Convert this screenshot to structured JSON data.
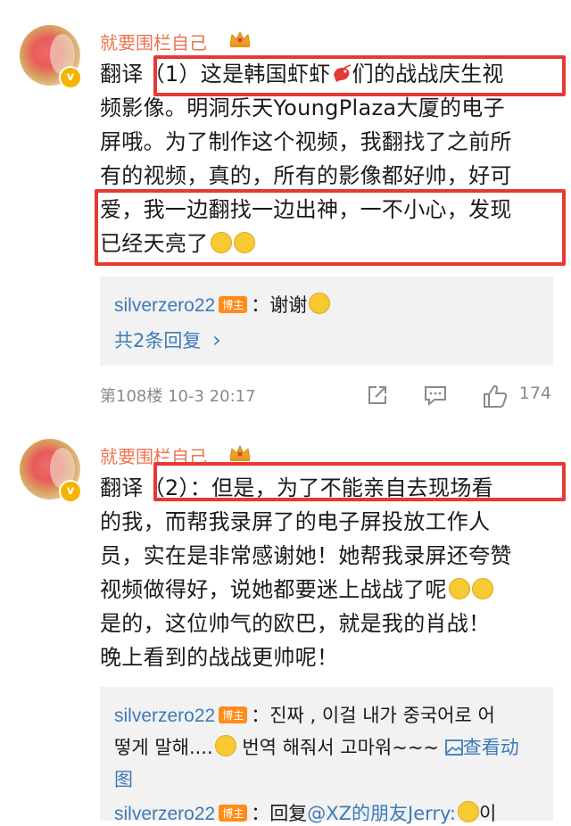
{
  "post1": {
    "username": "就要围栏自己",
    "content_lines": [
      "翻译（1）这是韩国虾虾",
      "们的战战庆生视",
      "频影像。明洞乐天YoungPlaza大厦的电子",
      "屏哦。为了制作这个视频，我翻找了之前所",
      "有的视频，真的，所有的影像都好帅，好可",
      "爱，我一边翻找一边出神，一不小心，发现",
      "已经天亮了"
    ],
    "reply": {
      "user": "silverzero22",
      "tag": "博主",
      "text": "：谢谢",
      "more": "共2条回复",
      "more_arrow": "›"
    },
    "footer": {
      "floor": "第108楼",
      "time": "10-3 20:17",
      "likes": "174"
    }
  },
  "post2": {
    "username": "就要围栏自己",
    "content_lines": [
      "翻译（2）：但是，为了不能亲自去现场看",
      "的我，而帮我录屏了的电子屏投放工作人",
      "员，实在是非常感谢她！她帮我录屏还夸赞",
      "视频做得好，说她都要迷上战战了呢",
      "是的，这位帅气的欧巴，就是我的肖战！",
      "晚上看到的战战更帅呢！"
    ],
    "reply1": {
      "user": "silverzero22",
      "tag": "博主",
      "text1": "：진짜 , 이걸 내가 중국어로 어",
      "text2a": "떻게 말해....",
      "text2b": " 번역 해줘서 고마워~~~ ",
      "view_image": "查看动",
      "text3": "图"
    },
    "reply2": {
      "user": "silverzero22",
      "tag": "博主",
      "text": "：回复",
      "mention": "@XZ的朋友Jerry",
      "tail": ":",
      "tail2": "이"
    }
  },
  "colors": {
    "username": "#eb7350",
    "link": "#3d7ab8",
    "highlight": "#e53935",
    "host_tag": "#ff8c1a"
  }
}
